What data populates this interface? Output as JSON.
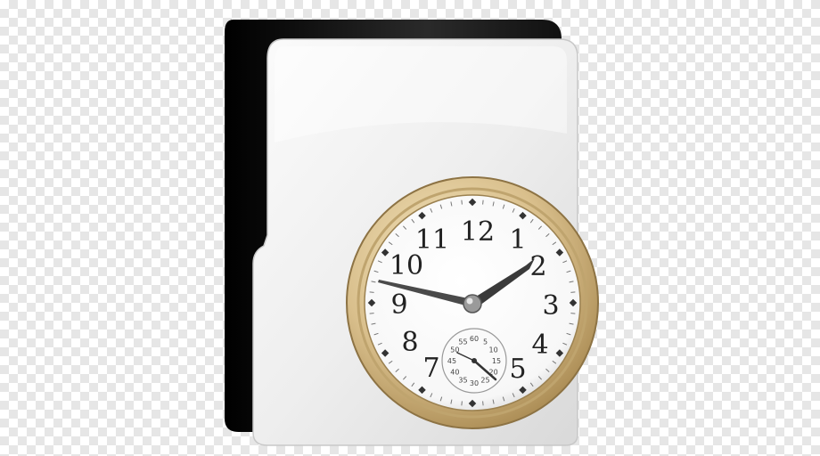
{
  "icon": {
    "name": "folder-with-clock",
    "folder_color": "#f2f2f2",
    "folder_back_color": "#1a1a1a",
    "clock_rim_color": "#d8bf8a",
    "clock_face_color": "#ffffff",
    "clock_numerals": [
      "12",
      "1",
      "2",
      "3",
      "4",
      "5",
      "7",
      "8",
      "9",
      "10",
      "11"
    ],
    "subdial_numerals": [
      "60",
      "5",
      "10",
      "15",
      "20",
      "25",
      "30",
      "35",
      "40",
      "45",
      "50",
      "55"
    ],
    "time": {
      "hour_hand_points_to": "2",
      "minute_hand_points_to": "10"
    }
  }
}
